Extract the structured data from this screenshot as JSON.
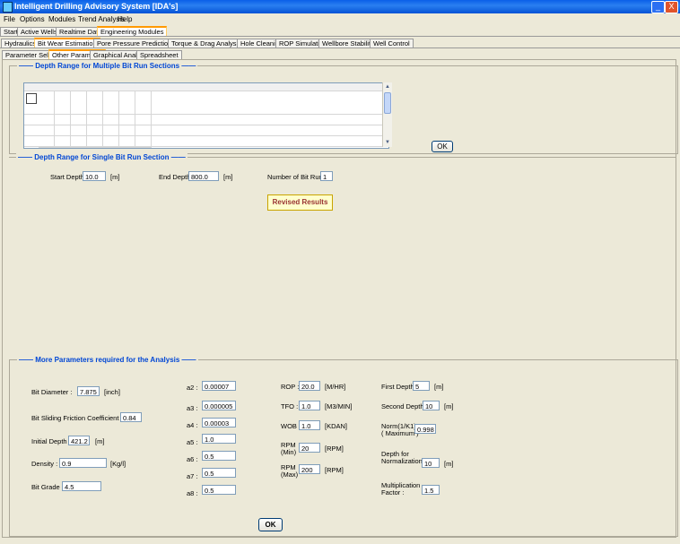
{
  "window": {
    "title": "Intelligent Drilling Advisory System  [IDA's]",
    "minimize": "_",
    "close": "X"
  },
  "menu": [
    "File",
    "Options",
    "Modules",
    "Trend Analysis",
    "Help"
  ],
  "main_tabs": [
    "Start",
    "Active Wells",
    "Realtime Data",
    "Engineering Modules"
  ],
  "module_tabs": [
    "Hydraulics",
    "Bit Wear Estimation",
    "Pore Pressure Prediction",
    "Torque & Drag Analysis",
    "Hole Cleaning",
    "ROP Simulation",
    "Wellbore Stability",
    "Well Control"
  ],
  "sub_tabs": [
    "Parameter Selection",
    "Other Parameter",
    "Graphical Analysis",
    "Spreadsheet"
  ],
  "multi_section": {
    "title": "Depth Range for Multiple Bit Run Sections",
    "ok_button": "OK"
  },
  "single_section": {
    "title": "Depth Range for Single Bit Run Section",
    "start_depth_label": "Start Depth :",
    "start_depth": "10.0",
    "start_unit": "[m]",
    "end_depth_label": "End Depth :",
    "end_depth": "800.0",
    "end_unit": "[m]",
    "bit_run_label": "Number of Bit Run :",
    "bit_run": "1",
    "revised_button": "Revised Results"
  },
  "params": {
    "title": "More Parameters required for the Analysis",
    "bit_diameter_label": "Bit Diameter :",
    "bit_diameter": "7.875",
    "bit_diameter_unit": "[inch]",
    "friction_label": "Bit Sliding Friction Coefficient :",
    "friction": "0.84",
    "initial_depth_label": "Initial Depth :",
    "initial_depth": "421.2",
    "initial_depth_unit": "[m]",
    "density_label": "Density :",
    "density": "0.9",
    "density_unit": "[Kg/l]",
    "bit_grade_label": "Bit Grade :",
    "bit_grade": "4.5",
    "a2_label": "a2 :",
    "a2": "0.00007",
    "a3_label": "a3 :",
    "a3": "0.000005",
    "a4_label": "a4 :",
    "a4": "0.00003",
    "a5_label": "a5 :",
    "a5": "1.0",
    "a6_label": "a6 :",
    "a6": "0.5",
    "a7_label": "a7 :",
    "a7": "0.5",
    "a8_label": "a8 :",
    "a8": "0.5",
    "rop_label": "ROP :",
    "rop": "20.0",
    "rop_unit": "[M/HR]",
    "tfo_label": "TFO :",
    "tfo": "1.0",
    "tfo_unit": "[M3/MIN]",
    "wob_label": "WOB",
    "wob": "1.0",
    "wob_unit": "[KDAN]",
    "rpm_min_label": "RPM\n(Min)",
    "rpm_min": "20",
    "rpm_min_unit": "[RPM]",
    "rpm_max_label": "RPM\n(Max)",
    "rpm_max": "200",
    "rpm_max_unit": "[RPM]",
    "first_depth_label": "First Depth :",
    "first_depth": "5",
    "first_depth_unit": "[m]",
    "second_depth_label": "Second Depth :",
    "second_depth": "10",
    "second_depth_unit": "[m]",
    "norm_label": "Norm(1/K1)\n( Maximum )",
    "norm": "0.998",
    "depth_norm_label": "Depth for\nNormalization :",
    "depth_norm": "10",
    "depth_norm_unit": "[m]",
    "mult_label": "Multiplication\nFactor :",
    "mult": "1.5",
    "ok_button": "OK"
  }
}
